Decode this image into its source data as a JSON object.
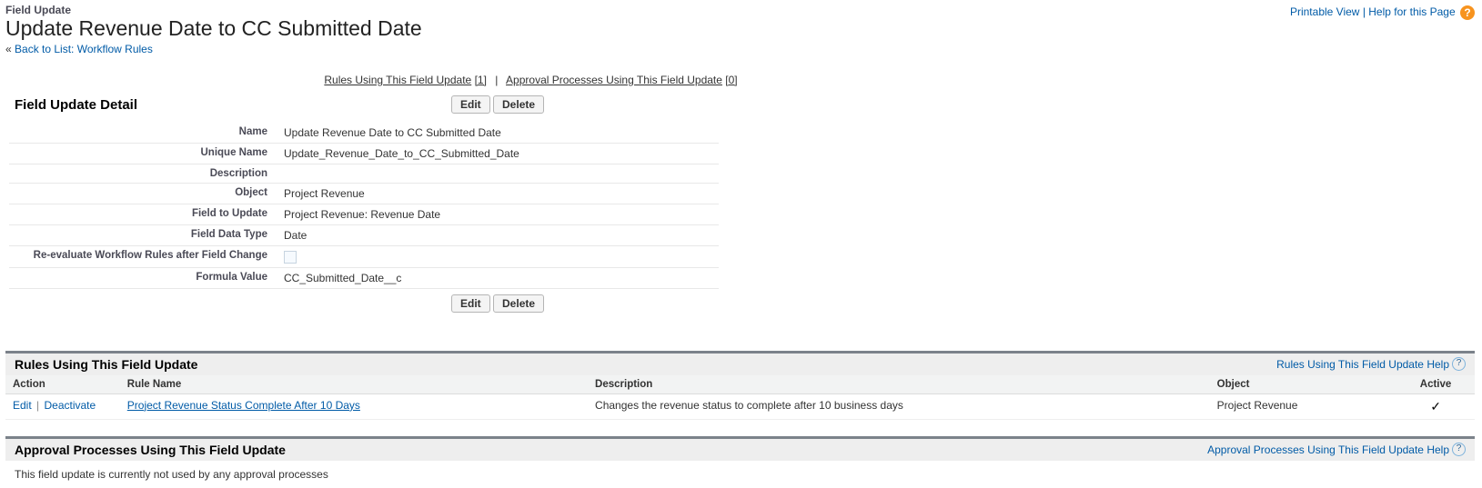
{
  "topLinks": {
    "printable": "Printable View",
    "help": "Help for this Page"
  },
  "header": {
    "crumb": "Field Update",
    "title": "Update Revenue Date to CC Submitted Date",
    "backPrefix": "« ",
    "backText": "Back to List: Workflow Rules"
  },
  "anchors": {
    "rulesLabel": "Rules Using This Field Update",
    "rulesCount": "[1]",
    "approvalsLabel": "Approval Processes Using This Field Update",
    "approvalsCount": "[0]",
    "sep": "|"
  },
  "detail": {
    "heading": "Field Update Detail",
    "buttons": {
      "edit": "Edit",
      "delete": "Delete"
    },
    "rows": {
      "nameLbl": "Name",
      "nameVal": "Update Revenue Date to CC Submitted Date",
      "uniqueLbl": "Unique Name",
      "uniqueVal": "Update_Revenue_Date_to_CC_Submitted_Date",
      "descLbl": "Description",
      "descVal": "",
      "objectLbl": "Object",
      "objectVal": "Project Revenue",
      "fieldLbl": "Field to Update",
      "fieldVal": "Project Revenue: Revenue Date",
      "typeLbl": "Field Data Type",
      "typeVal": "Date",
      "reevalLbl": "Re-evaluate Workflow Rules after Field Change",
      "formulaLbl": "Formula Value",
      "formulaVal": "CC_Submitted_Date__c"
    }
  },
  "rulesBlock": {
    "title": "Rules Using This Field Update",
    "helpLink": "Rules Using This Field Update Help",
    "columns": {
      "action": "Action",
      "ruleName": "Rule Name",
      "description": "Description",
      "object": "Object",
      "active": "Active"
    },
    "row": {
      "editAction": "Edit",
      "deactivateAction": "Deactivate",
      "ruleName": "Project Revenue Status Complete After 10 Days",
      "description": "Changes the revenue status to complete after 10 business days",
      "object": "Project Revenue",
      "activeMark": "✓"
    }
  },
  "approvalsBlock": {
    "title": "Approval Processes Using This Field Update",
    "helpLink": "Approval Processes Using This Field Update Help",
    "emptyMsg": "This field update is currently not used by any approval processes"
  }
}
